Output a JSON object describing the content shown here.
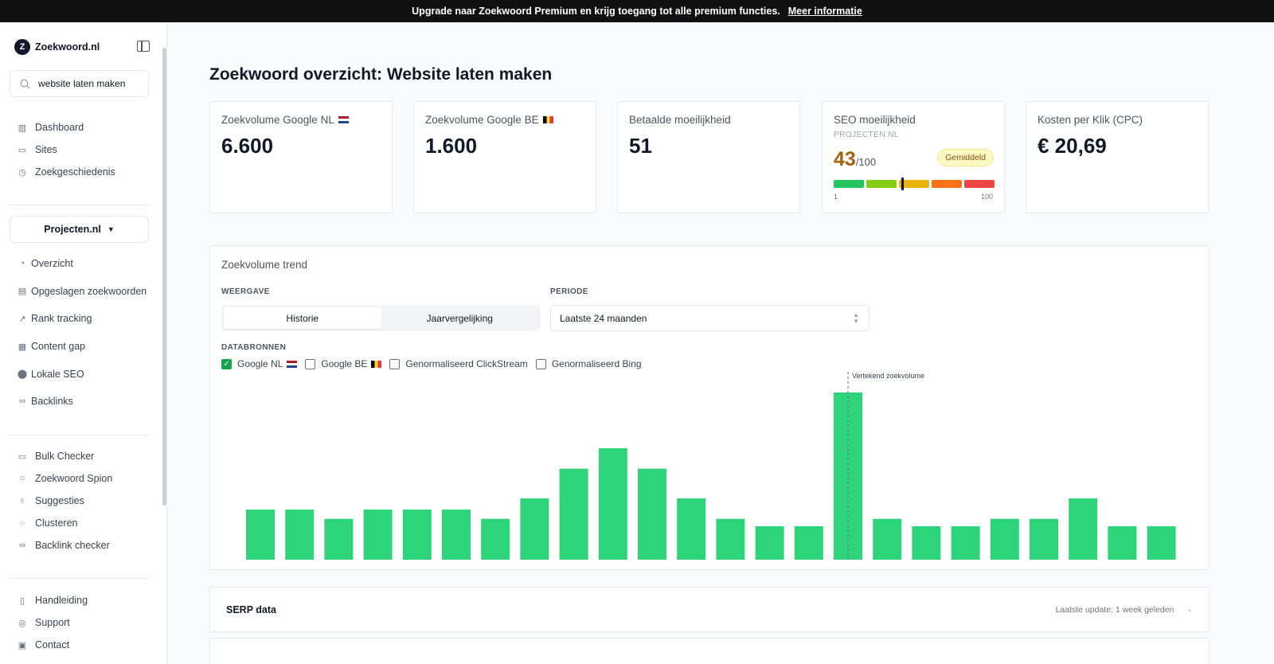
{
  "banner": {
    "text": "Upgrade naar Zoekwoord Premium en krijg toegang tot alle premium functies.",
    "link": "Meer informatie"
  },
  "sidebar": {
    "logo_letter": "Z",
    "logo_text": "Zoekwoord.nl",
    "search_value": "website laten maken",
    "top_items": [
      {
        "label": "Dashboard",
        "icon": "dashboard-icon"
      },
      {
        "label": "Sites",
        "icon": "sites-icon"
      },
      {
        "label": "Zoekgeschiedenis",
        "icon": "clock-icon"
      }
    ],
    "project": "Projecten.nl",
    "project_items": [
      {
        "label": "Overzicht",
        "icon": "pie-icon"
      },
      {
        "label": "Opgeslagen zoekwoorden",
        "icon": "keyboard-icon"
      },
      {
        "label": "Rank tracking",
        "icon": "trend-icon"
      },
      {
        "label": "Content gap",
        "icon": "table-icon"
      },
      {
        "label": "Lokale SEO",
        "icon": "pin-icon"
      },
      {
        "label": "Backlinks",
        "icon": "link-icon"
      }
    ],
    "tool_items": [
      {
        "label": "Bulk Checker",
        "icon": "archive-icon"
      },
      {
        "label": "Zoekwoord Spion",
        "icon": "search-icon"
      },
      {
        "label": "Suggesties",
        "icon": "bulb-icon"
      },
      {
        "label": "Clusteren",
        "icon": "grid-icon"
      },
      {
        "label": "Backlink checker",
        "icon": "link-icon"
      }
    ],
    "bottom_items": [
      {
        "label": "Handleiding",
        "icon": "book-icon"
      },
      {
        "label": "Support",
        "icon": "lifebuoy-icon"
      },
      {
        "label": "Contact",
        "icon": "contact-icon"
      }
    ]
  },
  "page": {
    "title_prefix": "Zoekwoord overzicht:",
    "title_keyword": "Website laten maken"
  },
  "cards": [
    {
      "label": "Zoekvolume Google NL",
      "value": "6.600"
    },
    {
      "label": "Zoekvolume Google BE",
      "value": "1.600"
    },
    {
      "label": "Betaalde moeilijkheid",
      "value": "51"
    },
    {
      "label": "SEO moeilijkheid",
      "sub": "PROJECTEN.NL",
      "score": "43",
      "max": "/100",
      "badge": "Gemiddeld",
      "min_label": "1",
      "max_label": "100",
      "level": 0.43
    },
    {
      "label": "Kosten per Klik (CPC)",
      "value": "€ 20,69"
    }
  ],
  "trend": {
    "title": "Zoekvolume trend",
    "weergave_label": "WEERGAVE",
    "tabs": [
      "Historie",
      "Jaarvergelijking"
    ],
    "periode_label": "PERIODE",
    "periode_value": "Laatste 24 maanden",
    "bronnen_label": "DATABRONNEN",
    "sources": [
      {
        "label": "Google NL",
        "checked": true
      },
      {
        "label": "Google BE",
        "checked": false
      },
      {
        "label": "Genormaliseerd ClickStream",
        "checked": false
      },
      {
        "label": "Genormaliseerd Bing",
        "checked": false
      }
    ],
    "annotation": "Vertekend zoekvolume"
  },
  "chart_data": {
    "type": "bar",
    "values": [
      27,
      27,
      22,
      27,
      27,
      27,
      22,
      33,
      49,
      60,
      49,
      33,
      22,
      18,
      18,
      90,
      22,
      18,
      18,
      22,
      22,
      33,
      18,
      18
    ],
    "annotated_index": 15,
    "color": "#2ed47a"
  },
  "serp": {
    "title": "SERP data",
    "update": "Laatste update: 1 week geleden"
  }
}
